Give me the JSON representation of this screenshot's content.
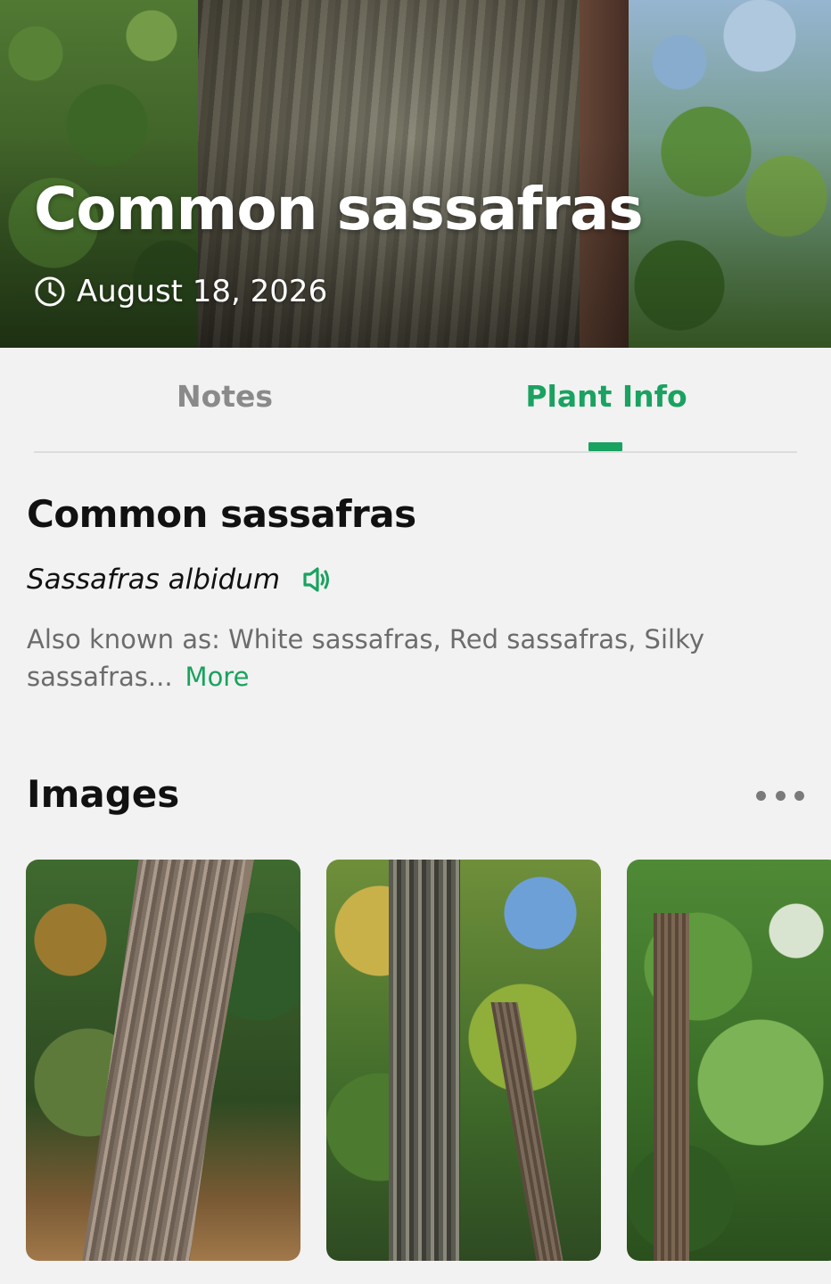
{
  "header": {
    "title": "Common sassafras",
    "date": "August 18, 2026",
    "date_icon": "clock-icon"
  },
  "tabs": [
    {
      "label": "Notes",
      "active": false
    },
    {
      "label": "Plant Info",
      "active": true
    }
  ],
  "plant": {
    "common_name": "Common sassafras",
    "scientific_name": "Sassafras albidum",
    "pronounce_icon": "speaker-icon",
    "also_known_as": "Also known as: White sassafras, Red sassafras, Silky sassafras...",
    "more_label": "More"
  },
  "images": {
    "title": "Images",
    "more_icon": "more-horizontal-icon",
    "items": [
      {
        "description_icon": "tree-trunk-photo"
      },
      {
        "description_icon": "tree-trunk-photo"
      },
      {
        "description_icon": "foliage-photo"
      }
    ]
  },
  "colors": {
    "accent": "#1aa260",
    "inactive_tab": "#8a8a8a",
    "secondary_text": "#6c6c6c",
    "background": "#f2f2f2"
  }
}
